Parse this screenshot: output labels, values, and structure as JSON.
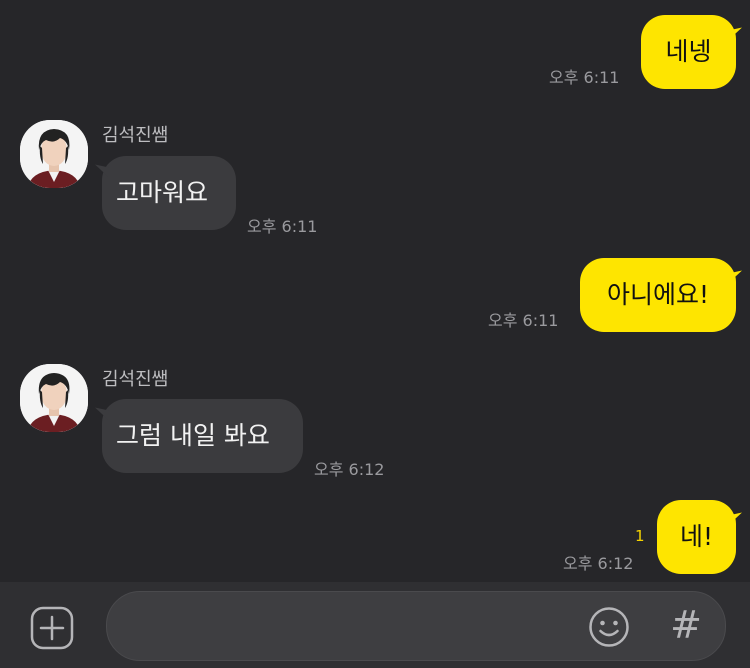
{
  "messages": [
    {
      "from": "me",
      "text": "네넹",
      "time": "오후 6:11"
    },
    {
      "from": "other",
      "sender": "김석진쌤",
      "text": "고마워요",
      "time": "오후 6:11"
    },
    {
      "from": "me",
      "text": "아니에요!",
      "time": "오후 6:11"
    },
    {
      "from": "other",
      "sender": "김석진쌤",
      "text": "그럼 내일 봐요",
      "time": "오후 6:12"
    },
    {
      "from": "me",
      "text": "네!",
      "time": "오후 6:12",
      "unread": "1"
    }
  ],
  "input": {
    "value": "",
    "placeholder": "",
    "hash_label": "#"
  },
  "icons": {
    "add": "plus-circle-icon",
    "emoji": "smiley-icon",
    "hash": "hash-icon"
  },
  "colors": {
    "background": "#262629",
    "my_bubble": "#FEE500",
    "other_bubble": "#3B3B3E",
    "unread_count": "#F5D300",
    "timestamp": "#9A9A9E"
  }
}
